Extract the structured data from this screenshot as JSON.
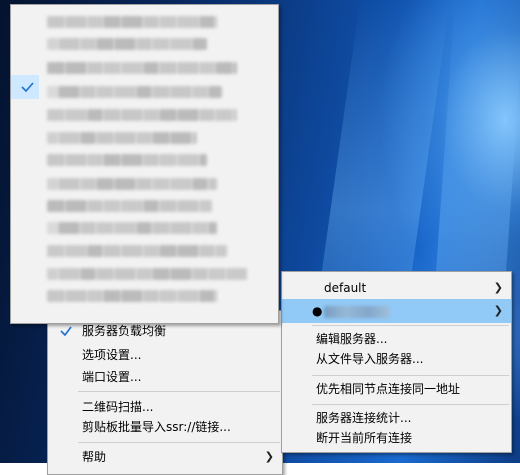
{
  "main_menu": {
    "items": [
      {
        "label": "服务器负载均衡",
        "checked": true
      },
      {
        "label": "选项设置..."
      },
      {
        "label": "端口设置..."
      },
      {
        "label": "二维码扫描..."
      },
      {
        "label": "剪贴板批量导入ssr://链接..."
      },
      {
        "label": "帮助"
      }
    ]
  },
  "server_submenu": {
    "items": [
      {
        "label": "default"
      },
      {
        "label": "●"
      },
      {
        "label": "编辑服务器..."
      },
      {
        "label": "从文件导入服务器..."
      },
      {
        "label": "优先相同节点连接同一地址"
      },
      {
        "label": "服务器连接统计..."
      },
      {
        "label": "断开当前所有连接"
      }
    ]
  },
  "server_list_menu": {
    "checked_index": 3
  },
  "colors": {
    "menu_bg": "#f2f2f2",
    "highlight": "#91c9f7",
    "check": "#1f6fd0"
  }
}
